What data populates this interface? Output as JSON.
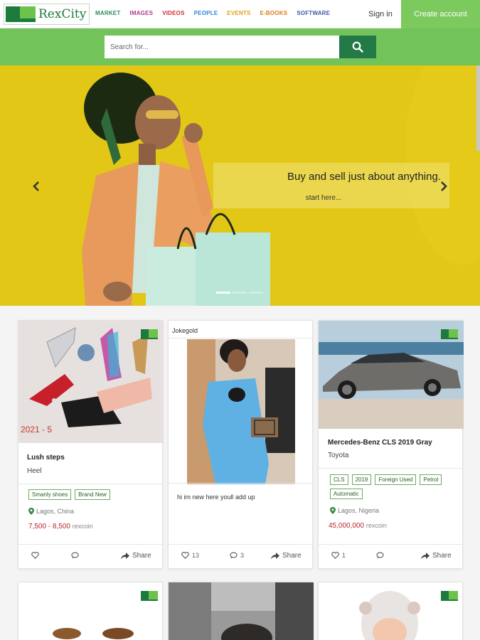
{
  "brand": {
    "name": "RexCity",
    "green_dark": "#1c7a3c",
    "green_light": "#6cc24a"
  },
  "nav": [
    {
      "label": "MARKET",
      "color": "#2e8b57"
    },
    {
      "label": "IMAGES",
      "color": "#b03a8c"
    },
    {
      "label": "VIDEOS",
      "color": "#d32f2f"
    },
    {
      "label": "PEOPLE",
      "color": "#2f86d6"
    },
    {
      "label": "EVENTS",
      "color": "#e0a21b"
    },
    {
      "label": "E-BOOKS",
      "color": "#e07a1b"
    },
    {
      "label": "SOFTWARE",
      "color": "#3d5ba9"
    }
  ],
  "header": {
    "signin_label": "Sign in",
    "create_label": "Create account"
  },
  "search": {
    "placeholder": "Search for...",
    "button_icon": "search-icon"
  },
  "hero": {
    "title": "Buy and sell just about anything.",
    "subtitle": "start here...",
    "slide_count": 3,
    "active_slide": 1
  },
  "cards": [
    {
      "title": "Lush steps",
      "subtitle": "Heel",
      "image_caption": "2021 - 5",
      "tags": [
        "Smanly shoes",
        "Brand New"
      ],
      "location": "Lagos, China",
      "price": "7,500 - 8,500",
      "currency": "rexcoin",
      "likes": "",
      "comments": "",
      "share_label": "Share"
    },
    {
      "poster": "Jokegold",
      "message": "hi im new here youll add up",
      "likes": "13",
      "comments": "3",
      "share_label": "Share"
    },
    {
      "title": "Mercedes-Benz CLS 2019 Gray",
      "subtitle": "Toyota",
      "tags": [
        "CLS",
        "2019",
        "Foreign Used",
        "Petrol",
        "Automatic"
      ],
      "location": "Lagos, Nigeria",
      "price": "45,000,000",
      "currency": "rexcoin",
      "likes": "1",
      "comments": "",
      "share_label": "Share"
    }
  ]
}
